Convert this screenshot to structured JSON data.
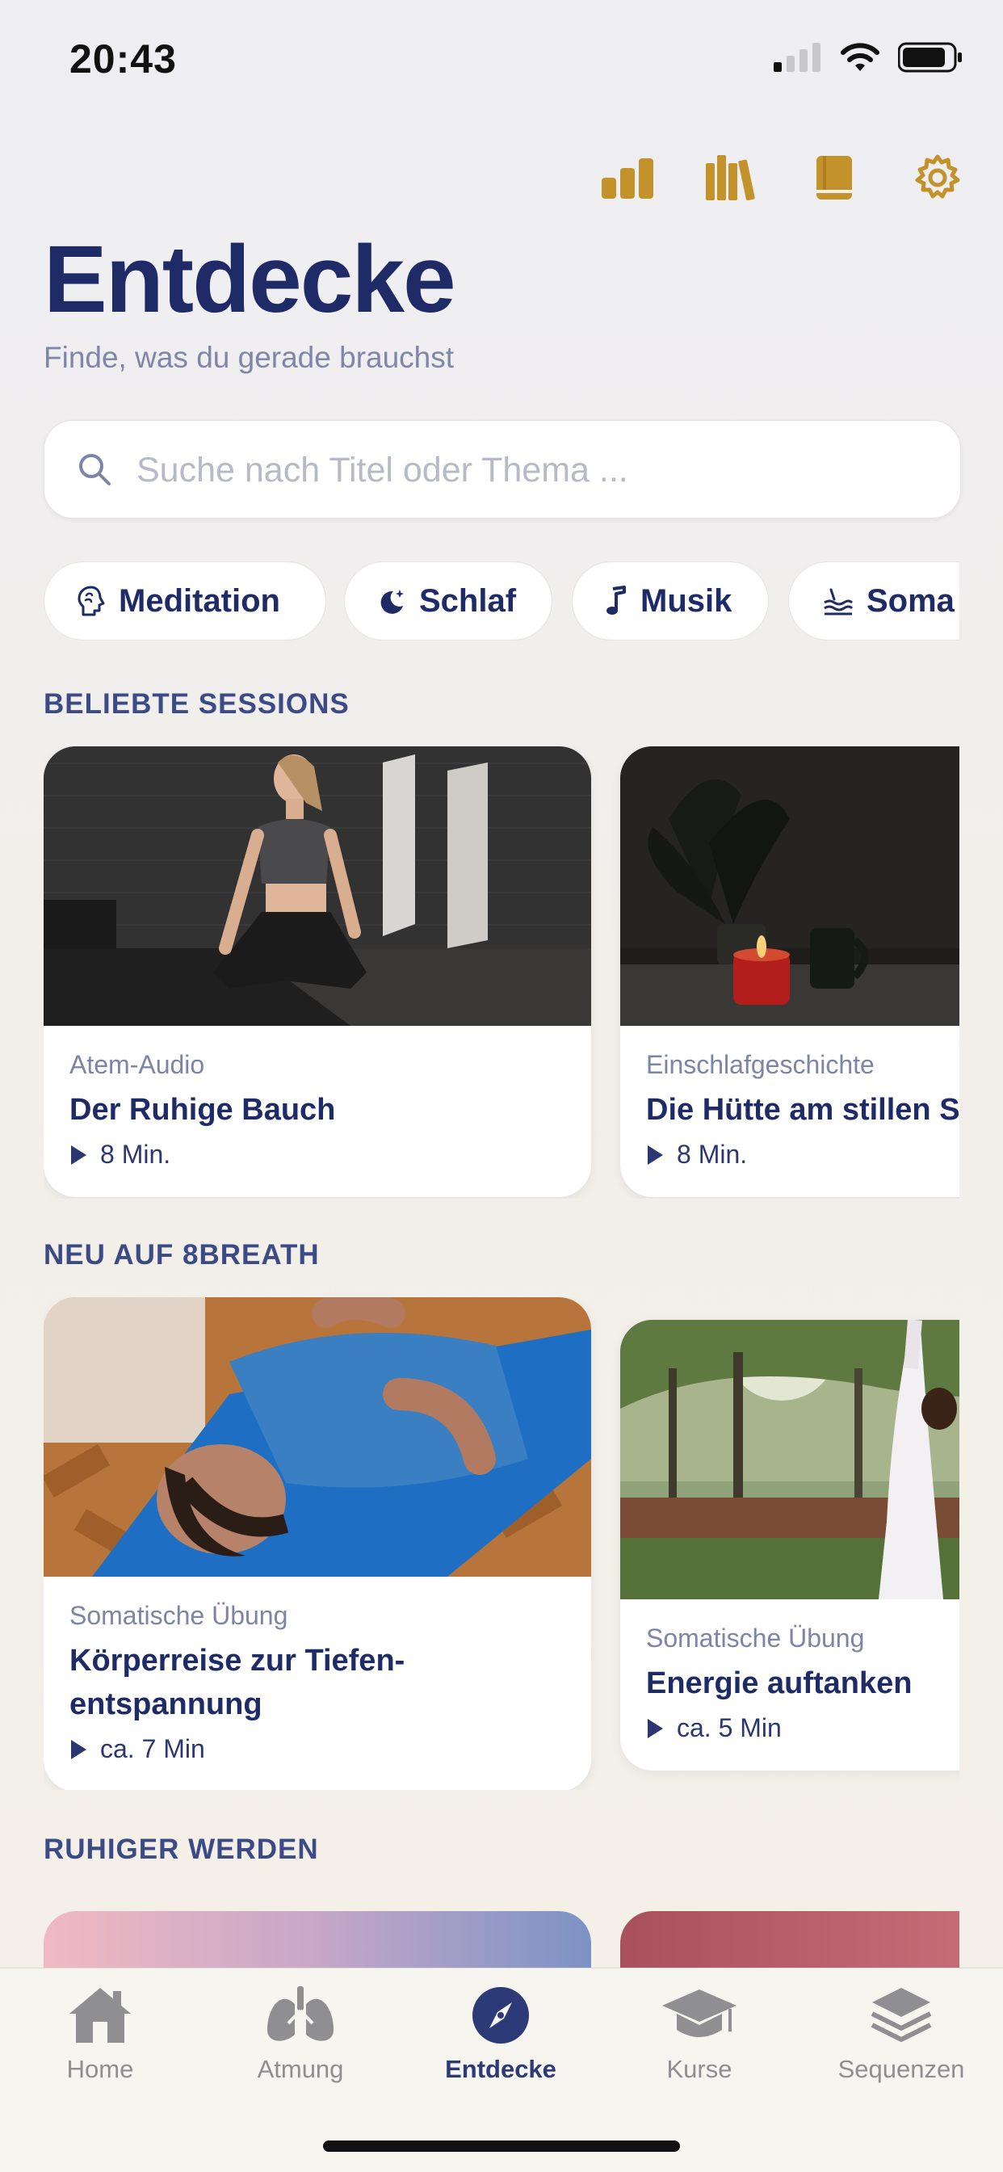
{
  "status_bar": {
    "time": "20:43"
  },
  "header": {
    "title": "Entdecke",
    "subtitle": "Finde, was du gerade brauchst",
    "icons": [
      "stats-icon",
      "library-icon",
      "book-icon",
      "gear-icon"
    ]
  },
  "search": {
    "placeholder": "Suche nach Titel oder Thema ..."
  },
  "chips": [
    {
      "label": "Meditation",
      "icon": "head-icon"
    },
    {
      "label": "Schlaf",
      "icon": "moon-icon"
    },
    {
      "label": "Musik",
      "icon": "music-note-icon"
    },
    {
      "label": "Soma",
      "icon": "waves-icon"
    }
  ],
  "sections": [
    {
      "label": "BELIEBTE SESSIONS",
      "cards": [
        {
          "category": "Atem-Audio",
          "title": "Der Ruhige Bauch",
          "duration": "8 Min."
        },
        {
          "category": "Einschlafgeschichte",
          "title": "Die Hütte am stillen S",
          "duration": "8 Min."
        }
      ]
    },
    {
      "label": "NEU AUF 8BREATH",
      "cards": [
        {
          "category": "Somatische Übung",
          "title": "Körperreise zur Tiefen-entspannung",
          "duration": "ca. 7 Min"
        },
        {
          "category": "Somatische Übung",
          "title": "Energie auftanken",
          "duration": "ca. 5 Min"
        }
      ]
    },
    {
      "label": "RUHIGER WERDEN",
      "cards": []
    }
  ],
  "tabbar": {
    "items": [
      {
        "label": "Home",
        "icon": "home-icon"
      },
      {
        "label": "Atmung",
        "icon": "lungs-icon"
      },
      {
        "label": "Entdecke",
        "icon": "compass-icon",
        "active": true
      },
      {
        "label": "Kurse",
        "icon": "graduation-cap-icon"
      },
      {
        "label": "Sequenzen",
        "icon": "layers-icon"
      }
    ]
  },
  "colors": {
    "accent_gold": "#c4922a",
    "navy": "#1e2b67",
    "active_tab": "#2d3a78"
  }
}
